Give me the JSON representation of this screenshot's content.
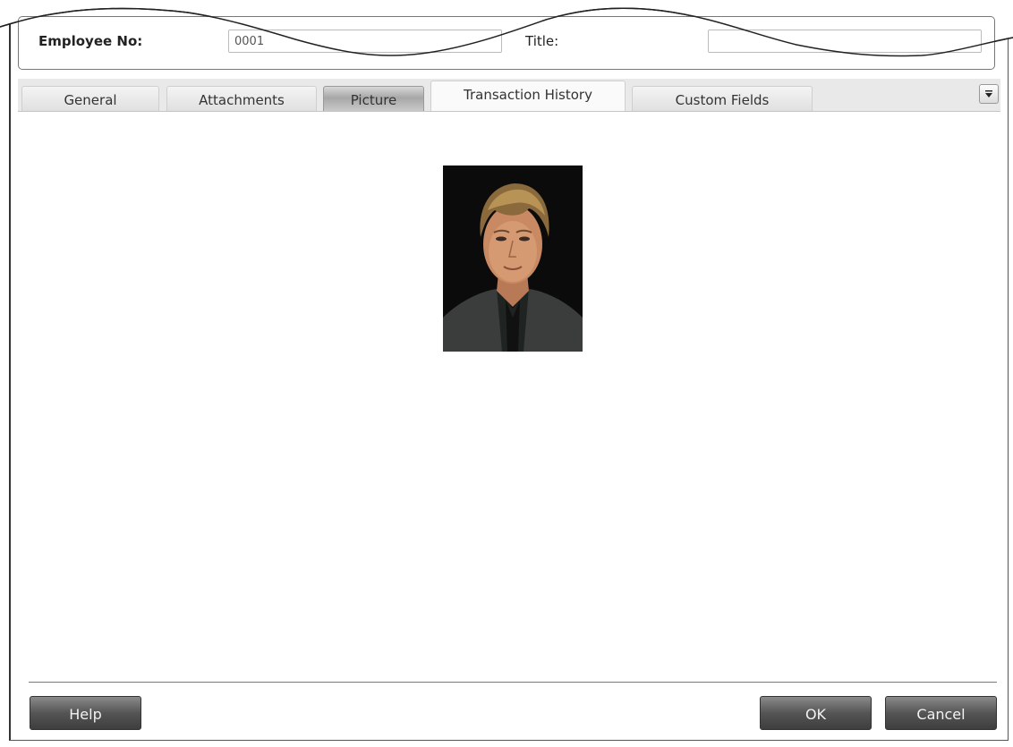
{
  "header": {
    "employee_no_label": "Employee No:",
    "employee_no_value": "0001",
    "title_label": "Title:",
    "title_value": ""
  },
  "tabs": [
    {
      "label": "General"
    },
    {
      "label": "Attachments"
    },
    {
      "label": "Picture",
      "active": true
    },
    {
      "label": "Transaction History"
    },
    {
      "label": "Custom Fields"
    }
  ],
  "tab_menu_icon": "triangle-down-icon",
  "picture": {
    "alt": "employee-photo"
  },
  "footer": {
    "help_label": "Help",
    "ok_label": "OK",
    "cancel_label": "Cancel"
  }
}
